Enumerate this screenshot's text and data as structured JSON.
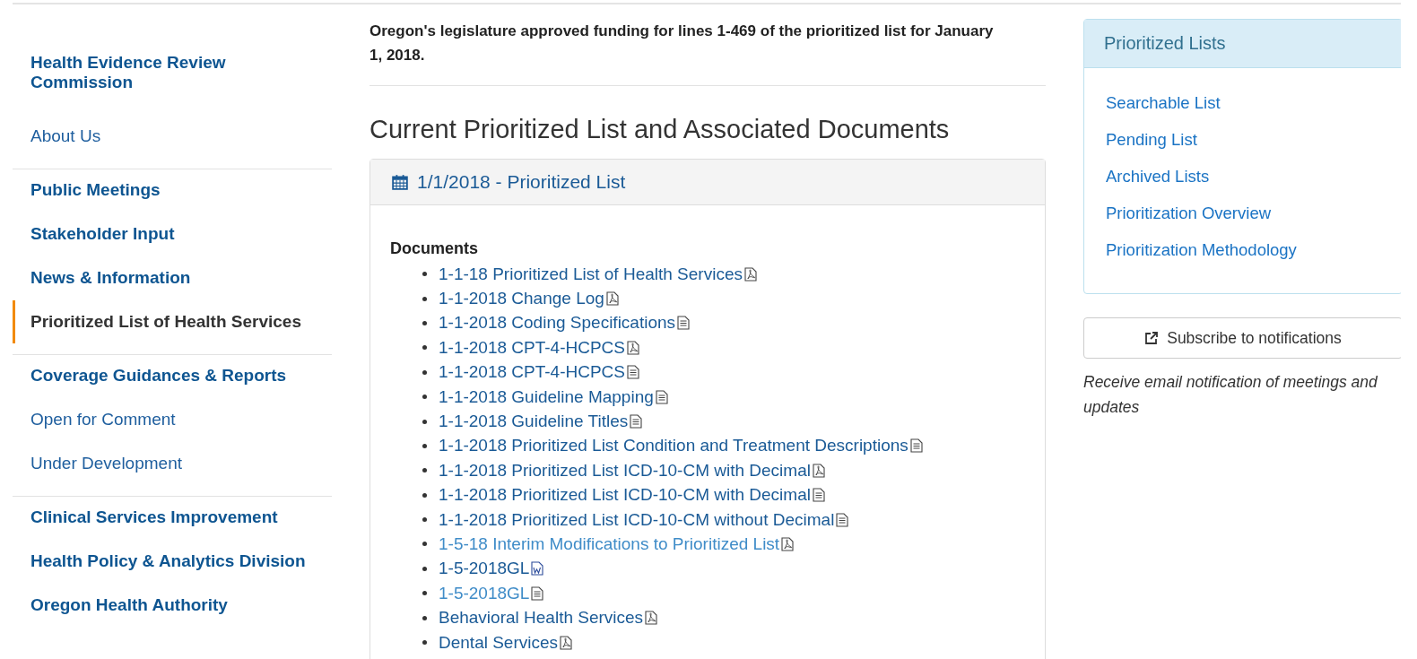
{
  "sidebar": {
    "groups": [
      {
        "items": [
          {
            "label": "Health Evidence Review Commission",
            "kind": "section",
            "selected": false
          },
          {
            "label": "About Us",
            "kind": "link",
            "selected": false
          }
        ]
      },
      {
        "items": [
          {
            "label": "Public Meetings",
            "kind": "section",
            "selected": false
          },
          {
            "label": "Stakeholder Input",
            "kind": "section",
            "selected": false
          },
          {
            "label": "News & Information",
            "kind": "section",
            "selected": false
          },
          {
            "label": "Prioritized List of Health Services",
            "kind": "section",
            "selected": true
          }
        ]
      },
      {
        "items": [
          {
            "label": "Coverage Guidances & Reports",
            "kind": "section",
            "selected": false
          },
          {
            "label": "Open for Comment",
            "kind": "link",
            "selected": false
          },
          {
            "label": "Under Development",
            "kind": "link",
            "selected": false
          }
        ]
      },
      {
        "items": [
          {
            "label": "Clinical Services Improvement",
            "kind": "section",
            "selected": false
          },
          {
            "label": "Health Policy & Analytics Division",
            "kind": "section",
            "selected": false
          },
          {
            "label": "Oregon Health Authority",
            "kind": "section",
            "selected": false
          }
        ]
      }
    ]
  },
  "main": {
    "notice": "Oregon's legislature approved funding for lines 1-469 of the prioritized list for January 1, 2018.",
    "heading": "Current Prioritized List and Associated Documents",
    "panel": {
      "title": "1/1/2018 - Prioritized List",
      "documents_label": "Documents",
      "documents": [
        {
          "label": "1-1-18 Prioritized List of Health Services",
          "kind": "pdf",
          "visited": false
        },
        {
          "label": "1-1-2018 Change Log",
          "kind": "pdf",
          "visited": false
        },
        {
          "label": "1-1-2018 Coding Specifications",
          "kind": "text",
          "visited": false
        },
        {
          "label": "1-1-2018 CPT-4-HCPCS",
          "kind": "pdf",
          "visited": false
        },
        {
          "label": "1-1-2018 CPT-4-HCPCS",
          "kind": "text",
          "visited": false
        },
        {
          "label": "1-1-2018 Guideline Mapping",
          "kind": "text",
          "visited": false
        },
        {
          "label": "1-1-2018 Guideline Titles",
          "kind": "text",
          "visited": false
        },
        {
          "label": "1-1-2018 Prioritized List Condition and Treatment Descriptions",
          "kind": "text",
          "visited": false
        },
        {
          "label": "1-1-2018 Prioritized List ICD-10-CM with Decimal",
          "kind": "pdf",
          "visited": false
        },
        {
          "label": "1-1-2018 Prioritized List ICD-10-CM with Decimal",
          "kind": "text",
          "visited": false
        },
        {
          "label": "1-1-2018 Prioritized List ICD-10-CM without Decimal",
          "kind": "text",
          "visited": false
        },
        {
          "label": "1-5-18 Interim Modifications to Prioritized List",
          "kind": "pdf",
          "visited": true
        },
        {
          "label": "1-5-2018GL",
          "kind": "word",
          "visited": false
        },
        {
          "label": "1-5-2018GL",
          "kind": "text",
          "visited": true
        },
        {
          "label": "Behavioral Health Services",
          "kind": "pdf",
          "visited": false
        },
        {
          "label": "Dental Services",
          "kind": "pdf",
          "visited": false
        }
      ]
    }
  },
  "aside": {
    "panel": {
      "title": "Prioritized Lists",
      "links": [
        "Searchable List",
        "Pending List",
        "Archived Lists",
        "Prioritization Overview",
        "Prioritization Methodology"
      ]
    },
    "subscribe_button": "Subscribe to notifications",
    "subscribe_note": "Receive email notification of meetings and updates"
  }
}
